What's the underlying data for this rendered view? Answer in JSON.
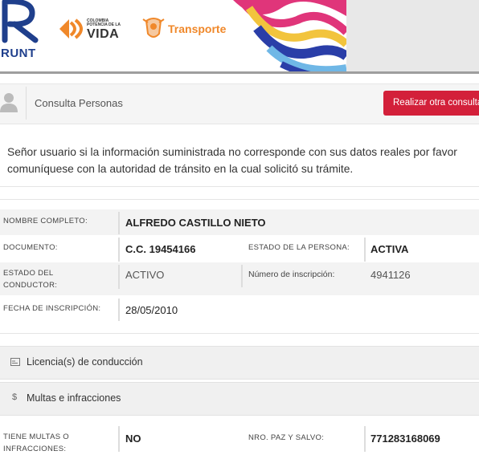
{
  "header": {
    "runt_logo_text": "RUNT",
    "gov_logo_small": "COLOMBIA POTENCIA DE LA",
    "gov_logo_big": "VIDA",
    "transport_logo_text": "Transporte"
  },
  "consulta": {
    "title": "Consulta Personas",
    "button_label": "Realizar otra consulta"
  },
  "notice": "Señor usuario si la información suministrada no corresponde con sus datos reales por favor comuníquese con la autoridad de tránsito en la cual solicitó su trámite.",
  "person": {
    "nombre_label": "NOMBRE COMPLETO:",
    "nombre_value": "ALFREDO CASTILLO NIETO",
    "documento_label": "DOCUMENTO:",
    "documento_value": "C.C. 19454166",
    "estado_persona_label": "ESTADO DE LA PERSONA:",
    "estado_persona_value": "ACTIVA",
    "estado_conductor_label": "ESTADO DEL CONDUCTOR:",
    "estado_conductor_value": "ACTIVO",
    "numero_inscripcion_label": "Número de inscripción:",
    "numero_inscripcion_value": "4941126",
    "fecha_inscripcion_label": "FECHA DE INSCRIPCIÓN:",
    "fecha_inscripcion_value": "28/05/2010"
  },
  "sections": {
    "licencias": "Licencia(s) de conducción",
    "multas": "Multas e infracciones",
    "multas_icon": "$"
  },
  "multas": {
    "tiene_label": "TIENE MULTAS O INFRACCIONES:",
    "tiene_value": "NO",
    "paz_label": "NRO. PAZ Y SALVO:",
    "paz_value": "771283168069"
  },
  "colors": {
    "button_red": "#d3203a",
    "runt_blue": "#1f3f8c",
    "transport_orange": "#f0882a"
  }
}
